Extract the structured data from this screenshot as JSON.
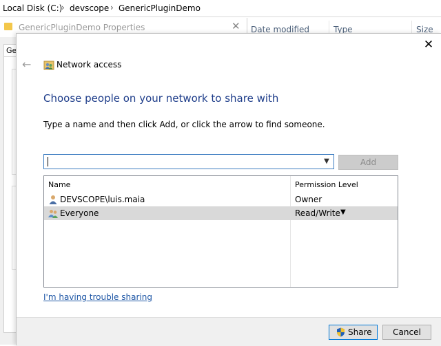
{
  "explorer": {
    "breadcrumb": [
      "Local Disk (C:)",
      "devscope",
      "GenericPluginDemo"
    ],
    "columns": [
      "Date modified",
      "Type",
      "Size"
    ]
  },
  "properties_window": {
    "title": "GenericPluginDemo Properties",
    "tab_partial": "Ge"
  },
  "dialog": {
    "title": "Network access",
    "heading": "Choose people on your network to share with",
    "instruction": "Type a name and then click Add, or click the arrow to find someone.",
    "name_input": {
      "value": ""
    },
    "add_label": "Add",
    "list": {
      "headers": {
        "name": "Name",
        "permission": "Permission Level"
      },
      "rows": [
        {
          "name": "DEVSCOPE\\luis.maia",
          "permission": "Owner",
          "icon": "user-icon"
        },
        {
          "name": "Everyone",
          "permission": "Read/Write",
          "icon": "group-icon",
          "selected": true
        }
      ]
    },
    "trouble_link": "I'm having trouble sharing",
    "share_label": "Share",
    "cancel_label": "Cancel"
  },
  "colors": {
    "heading": "#1e3d8a",
    "link": "#1f57a6",
    "selected_row": "#d9d9d9",
    "focus_border": "#3a7bc0"
  }
}
